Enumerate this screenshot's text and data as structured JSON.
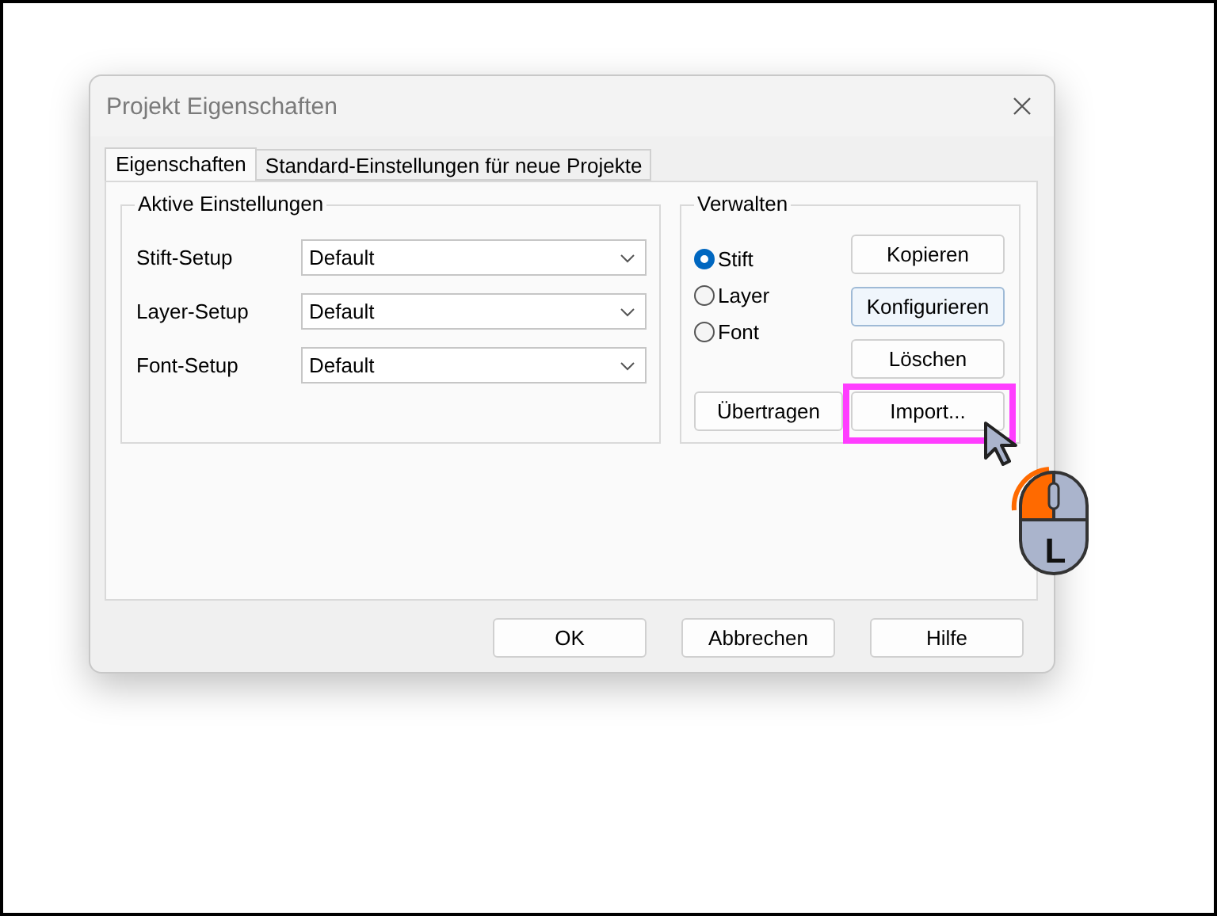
{
  "window": {
    "title": "Projekt Eigenschaften"
  },
  "tabs": [
    {
      "label": "Eigenschaften",
      "selected": true
    },
    {
      "label": "Standard-Einstellungen für neue Projekte",
      "selected": false
    }
  ],
  "active_settings": {
    "title": "Aktive Einstellungen",
    "rows": [
      {
        "label": "Stift-Setup",
        "value": "Default"
      },
      {
        "label": "Layer-Setup",
        "value": "Default"
      },
      {
        "label": "Font-Setup",
        "value": "Default"
      }
    ]
  },
  "manage": {
    "title": "Verwalten",
    "radios": [
      {
        "label": "Stift",
        "selected": true
      },
      {
        "label": "Layer",
        "selected": false
      },
      {
        "label": "Font",
        "selected": false
      }
    ],
    "buttons": [
      {
        "label": "Kopieren",
        "focused": false,
        "highlighted": false
      },
      {
        "label": "Konfigurieren",
        "focused": true,
        "highlighted": false
      },
      {
        "label": "Löschen",
        "focused": false,
        "highlighted": false
      },
      {
        "label": "Import...",
        "focused": false,
        "highlighted": true
      }
    ],
    "transfer_button": "Übertragen"
  },
  "footer_buttons": [
    "OK",
    "Abbrechen",
    "Hilfe"
  ],
  "mouse_hint": {
    "label": "L"
  }
}
